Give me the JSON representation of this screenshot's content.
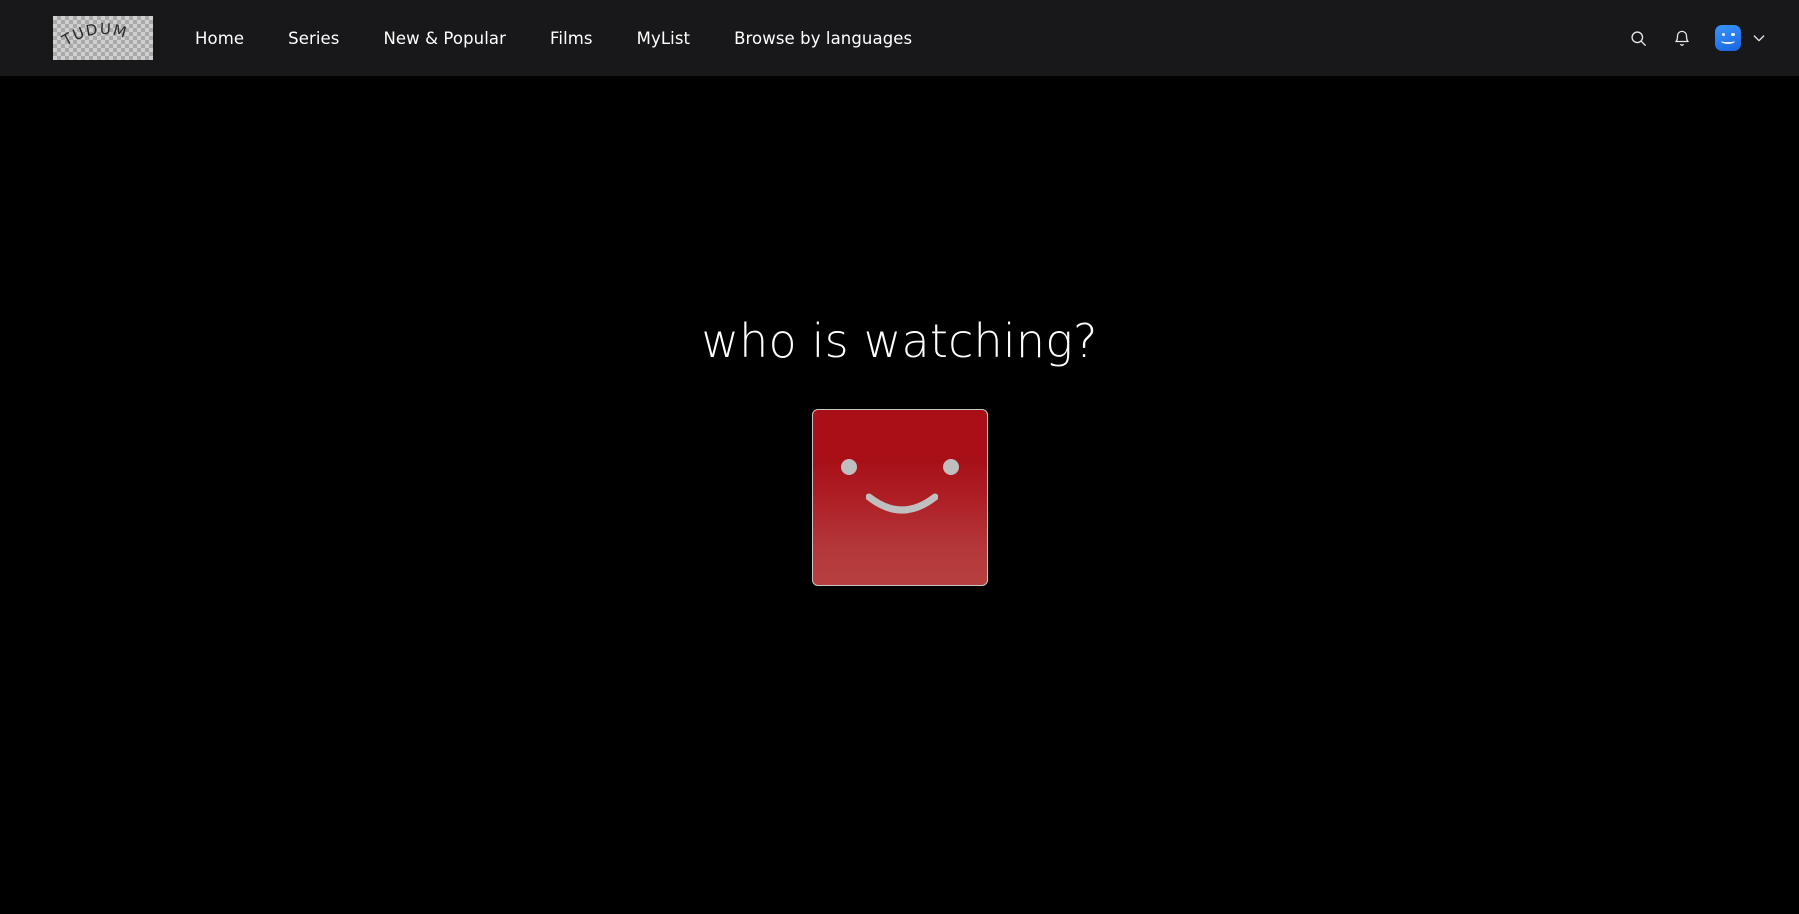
{
  "header": {
    "logo": {
      "name": "tudum-logo",
      "text": "TUDUM"
    },
    "nav_items": [
      {
        "label": "Home",
        "name": "nav-item-home"
      },
      {
        "label": "Series",
        "name": "nav-item-series"
      },
      {
        "label": "New & Popular",
        "name": "nav-item-new-and-popular"
      },
      {
        "label": "Films",
        "name": "nav-item-films"
      },
      {
        "label": "MyList",
        "name": "nav-item-mylist"
      },
      {
        "label": "Browse by languages",
        "name": "nav-item-browse-by-languages"
      }
    ],
    "icons": {
      "search": "search-icon",
      "notifications": "bell-icon",
      "avatar": "avatar",
      "chevron": "chevron-down-icon"
    },
    "colors": {
      "bar_background": "#18181a",
      "text": "#ffffff",
      "avatar_blue": "#2b7ff0"
    }
  },
  "main": {
    "headline": "who is watching?",
    "profiles": [
      {
        "name": "profile-card-1",
        "avatar_style": "red-smiley",
        "color_top": "#a80f17",
        "color_bottom": "#b6403f",
        "label": ""
      }
    ],
    "colors": {
      "background": "#000000",
      "headline_text": "#ffffff",
      "face_feature": "#bfbfbf",
      "card_border": "#c6c6c6"
    }
  }
}
